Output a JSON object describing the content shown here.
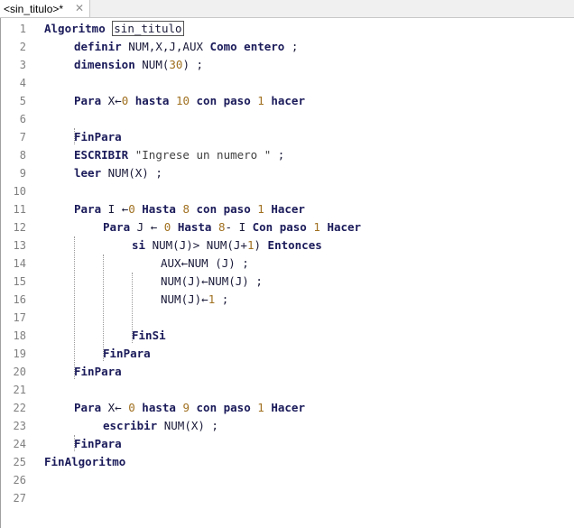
{
  "tab": {
    "label": "<sin_titulo>*",
    "close_glyph": "✕"
  },
  "line_numbers": [
    "1",
    "2",
    "3",
    "4",
    "5",
    "6",
    "7",
    "8",
    "9",
    "10",
    "11",
    "12",
    "13",
    "14",
    "15",
    "16",
    "17",
    "18",
    "19",
    "20",
    "21",
    "22",
    "23",
    "24",
    "25",
    "26",
    "27"
  ],
  "code": {
    "l1": {
      "kw": "Algoritmo",
      "name": "sin_titulo"
    },
    "l2": {
      "kw": "definir",
      "text": "NUM,X,J,AUX",
      "kw2": "Como entero",
      "end": ";"
    },
    "l3": {
      "kw": "dimension",
      "text": "NUM(",
      "num": "30",
      "end": ") ;"
    },
    "l5": {
      "kw": "Para",
      "t1": "X←",
      "n1": "0",
      "kw2": "hasta",
      "n2": "10",
      "kw3": "con paso",
      "n3": "1",
      "kw4": "hacer"
    },
    "l7": {
      "kw": "FinPara"
    },
    "l8": {
      "kw": "ESCRIBIR",
      "str": "\"Ingrese un numero \"",
      "end": ";"
    },
    "l9": {
      "kw": "leer",
      "text": "NUM(X) ;"
    },
    "l11": {
      "kw": "Para",
      "t1": "I ←",
      "n1": "0",
      "kw2": "Hasta",
      "n2": "8",
      "kw3": "con paso",
      "n3": "1",
      "kw4": "Hacer"
    },
    "l12": {
      "kw": "Para",
      "t1": "J ←",
      "n1": "0",
      "kw2": "Hasta",
      "n2": "8",
      "t2": "- I",
      "kw3": "Con paso",
      "n3": "1",
      "kw4": "Hacer"
    },
    "l13": {
      "kw": "si",
      "t1": "NUM(J)> NUM(J+",
      "n1": "1",
      "t2": ")",
      "kw2": "Entonces"
    },
    "l14": {
      "text": "AUX←NUM (J) ;"
    },
    "l15": {
      "text": "NUM(J)←NUM(J) ;"
    },
    "l16": {
      "t1": "NUM(J)←",
      "n1": "1",
      "t2": " ;"
    },
    "l18": {
      "kw": "FinSi"
    },
    "l19": {
      "kw": "FinPara"
    },
    "l20": {
      "kw": "FinPara"
    },
    "l22": {
      "kw": "Para",
      "t1": "X←",
      "n1": "0",
      "kw2": "hasta",
      "n2": "9",
      "kw3": "con paso",
      "n3": "1",
      "kw4": "Hacer"
    },
    "l23": {
      "kw": "escribir",
      "text": "NUM(X) ;"
    },
    "l24": {
      "kw": "FinPara"
    },
    "l25": {
      "kw": "FinAlgoritmo"
    }
  }
}
